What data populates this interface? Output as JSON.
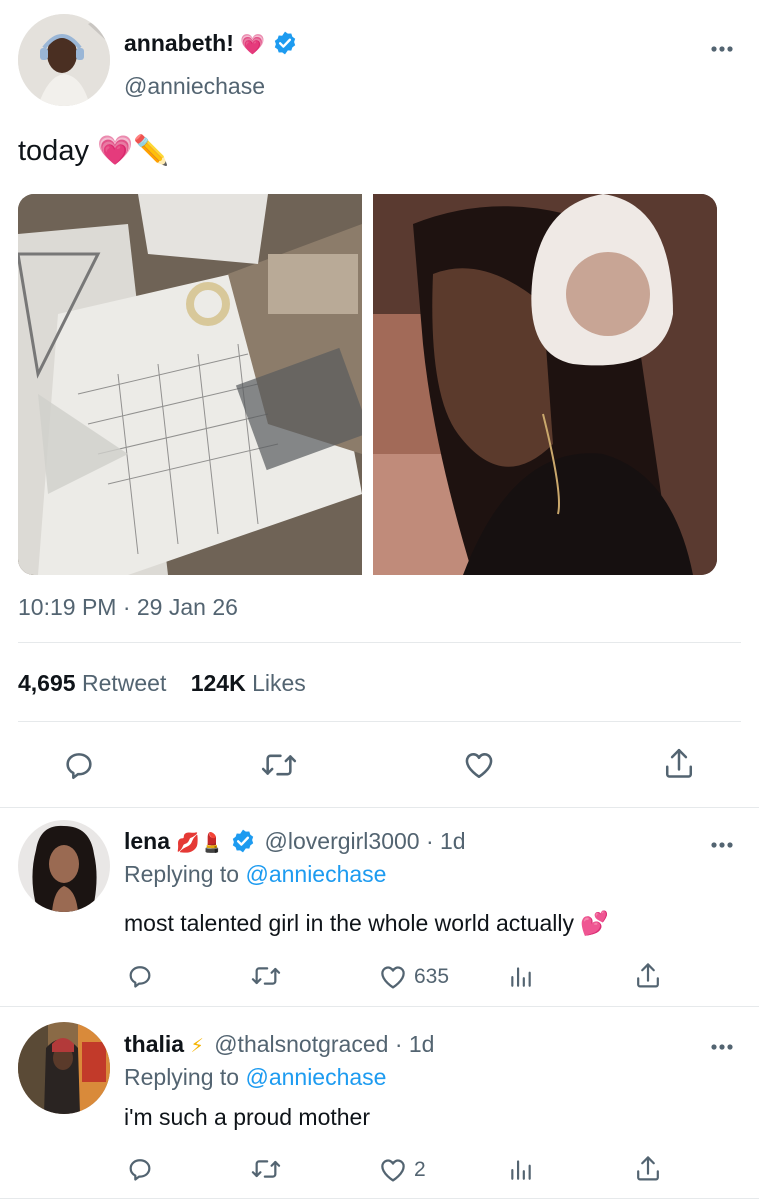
{
  "tweet": {
    "display_name": "annabeth!",
    "name_emoji": "💗",
    "handle": "@anniechase",
    "text": "today 💗✏️",
    "timestamp": "10:19 PM · 29 Jan 26",
    "retweets_count": "4,695",
    "retweets_label": "Retweet",
    "likes_count": "124K",
    "likes_label": "Likes"
  },
  "replies": [
    {
      "display_name": "lena",
      "name_emoji": "💋💄",
      "verified": true,
      "handle_time": "@lovergirl3000 · 1d",
      "replying_prefix": "Replying to",
      "replying_handle": "@anniechase",
      "text": "most talented girl in the whole world actually 💕",
      "like_count": "635"
    },
    {
      "display_name": "thalia",
      "name_emoji": "⚡",
      "verified": false,
      "handle_time": "@thalsnotgraced · 1d",
      "replying_prefix": "Replying to",
      "replying_handle": "@anniechase",
      "text": "i'm such a proud mother",
      "like_count": "2"
    }
  ],
  "colors": {
    "accent_blue": "#1d9bf0",
    "secondary_text": "#536471",
    "divider": "#e6e9eb"
  },
  "icons": [
    "more-icon",
    "verified-badge-icon",
    "reply-icon",
    "retweet-icon",
    "like-icon",
    "share-icon",
    "views-icon"
  ]
}
